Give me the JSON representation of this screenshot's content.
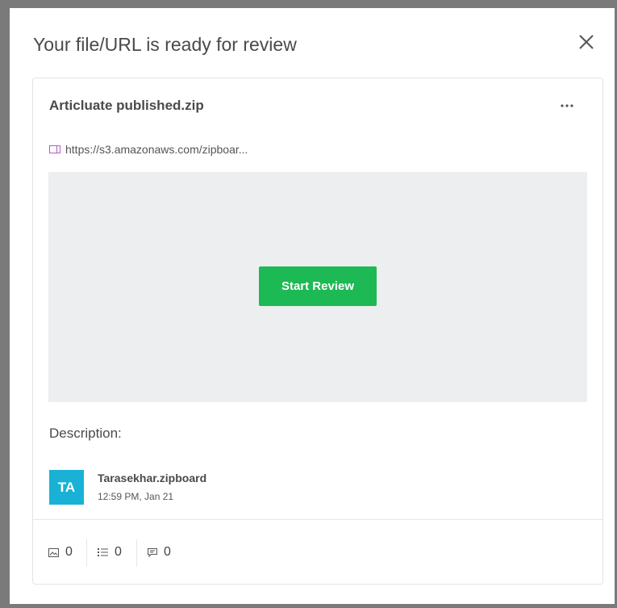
{
  "modal": {
    "title": "Your file/URL is ready for review",
    "close_icon": "close-icon"
  },
  "card": {
    "file_name": "Articluate published.zip",
    "more_icon": "more-horizontal-icon",
    "url": "https://s3.amazonaws.com/zipboar...",
    "url_icon": "window-icon",
    "start_button_label": "Start Review",
    "description_label": "Description:",
    "user": {
      "initials": "TA",
      "name": "Tarasekhar.zipboard",
      "timestamp": "12:59 PM, Jan 21"
    },
    "stats": {
      "images": "0",
      "tasks": "0",
      "comments": "0"
    }
  },
  "colors": {
    "accent_green": "#1db954",
    "avatar_blue": "#1ab1d6",
    "url_icon_purple": "#b05cc8",
    "preview_bg": "#eceeef"
  }
}
